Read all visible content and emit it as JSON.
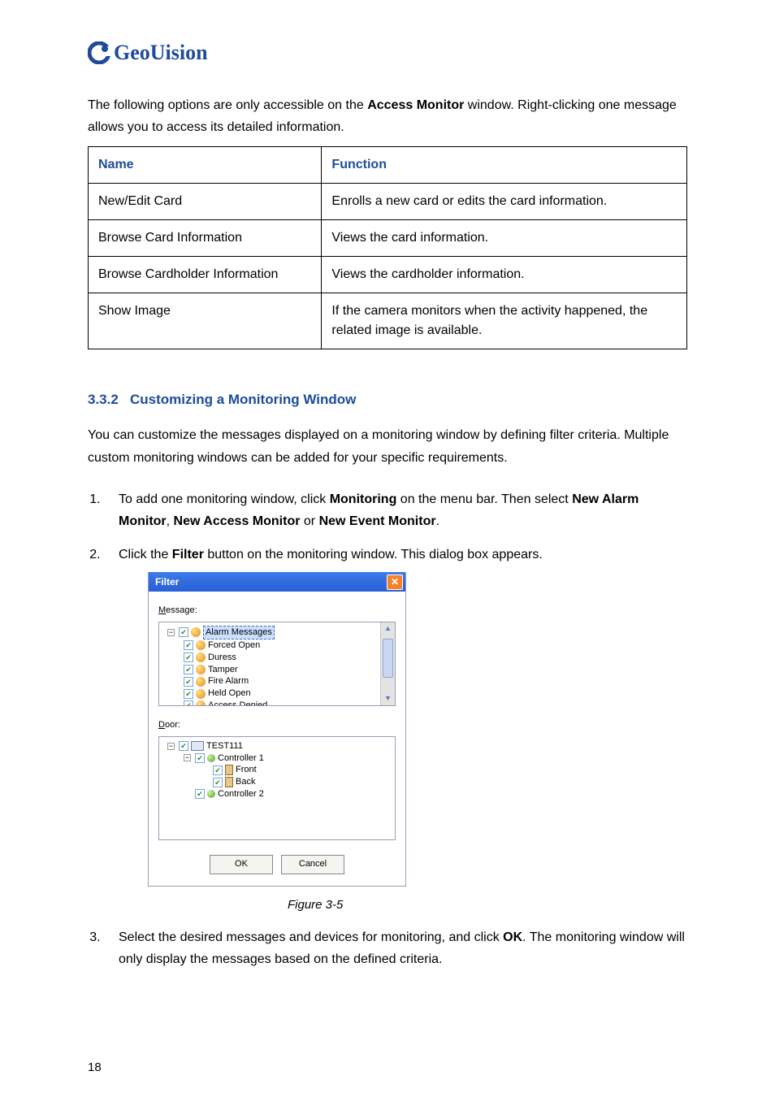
{
  "brand": "GeoUision",
  "intro_pre": "The following options are only accessible on the ",
  "intro_bold": "Access Monitor",
  "intro_post": " window. Right-clicking one message allows you to access its detailed information.",
  "table": {
    "headers": {
      "name": "Name",
      "function": "Function"
    },
    "rows": [
      {
        "name": "New/Edit Card",
        "function": "Enrolls a new card or edits the card information."
      },
      {
        "name": "Browse Card Information",
        "function": "Views the card information."
      },
      {
        "name": "Browse Cardholder Information",
        "function": "Views the cardholder information."
      },
      {
        "name": "Show Image",
        "function": "If the camera monitors when the activity happened, the related image is available."
      }
    ]
  },
  "section": {
    "number": "3.3.2",
    "title": "Customizing a Monitoring Window"
  },
  "section_p": "You can customize the messages displayed on a monitoring window by defining filter criteria. Multiple custom monitoring windows can be added for your specific requirements.",
  "steps": {
    "s1": {
      "pre": "To add one monitoring window, click ",
      "b1": "Monitoring",
      "mid1": " on the menu bar. Then select ",
      "b2": "New Alarm Monitor",
      "sep1": ", ",
      "b3": "New Access Monitor",
      "sep2": " or ",
      "b4": "New Event Monitor",
      "end": "."
    },
    "s2": {
      "pre": "Click the ",
      "b1": "Filter",
      "post": " button on the monitoring window. This dialog box appears."
    },
    "s3": {
      "pre": "Select the desired messages and devices for monitoring, and click ",
      "b1": "OK",
      "post": ". The monitoring window will only display the messages based on the defined criteria."
    }
  },
  "dialog": {
    "title": "Filter",
    "message_label": "Message:",
    "door_label": "Door:",
    "msg_tree": {
      "root": "Alarm Messages",
      "items": [
        "Forced Open",
        "Duress",
        "Tamper",
        "Fire Alarm",
        "Held Open",
        "Access Denied"
      ]
    },
    "door_tree": {
      "host": "TEST111",
      "c1": "Controller 1",
      "c1_children": [
        "Front",
        "Back"
      ],
      "c2": "Controller 2"
    },
    "ok": "OK",
    "cancel": "Cancel"
  },
  "figure_caption": "Figure 3-5",
  "page_number": "18"
}
